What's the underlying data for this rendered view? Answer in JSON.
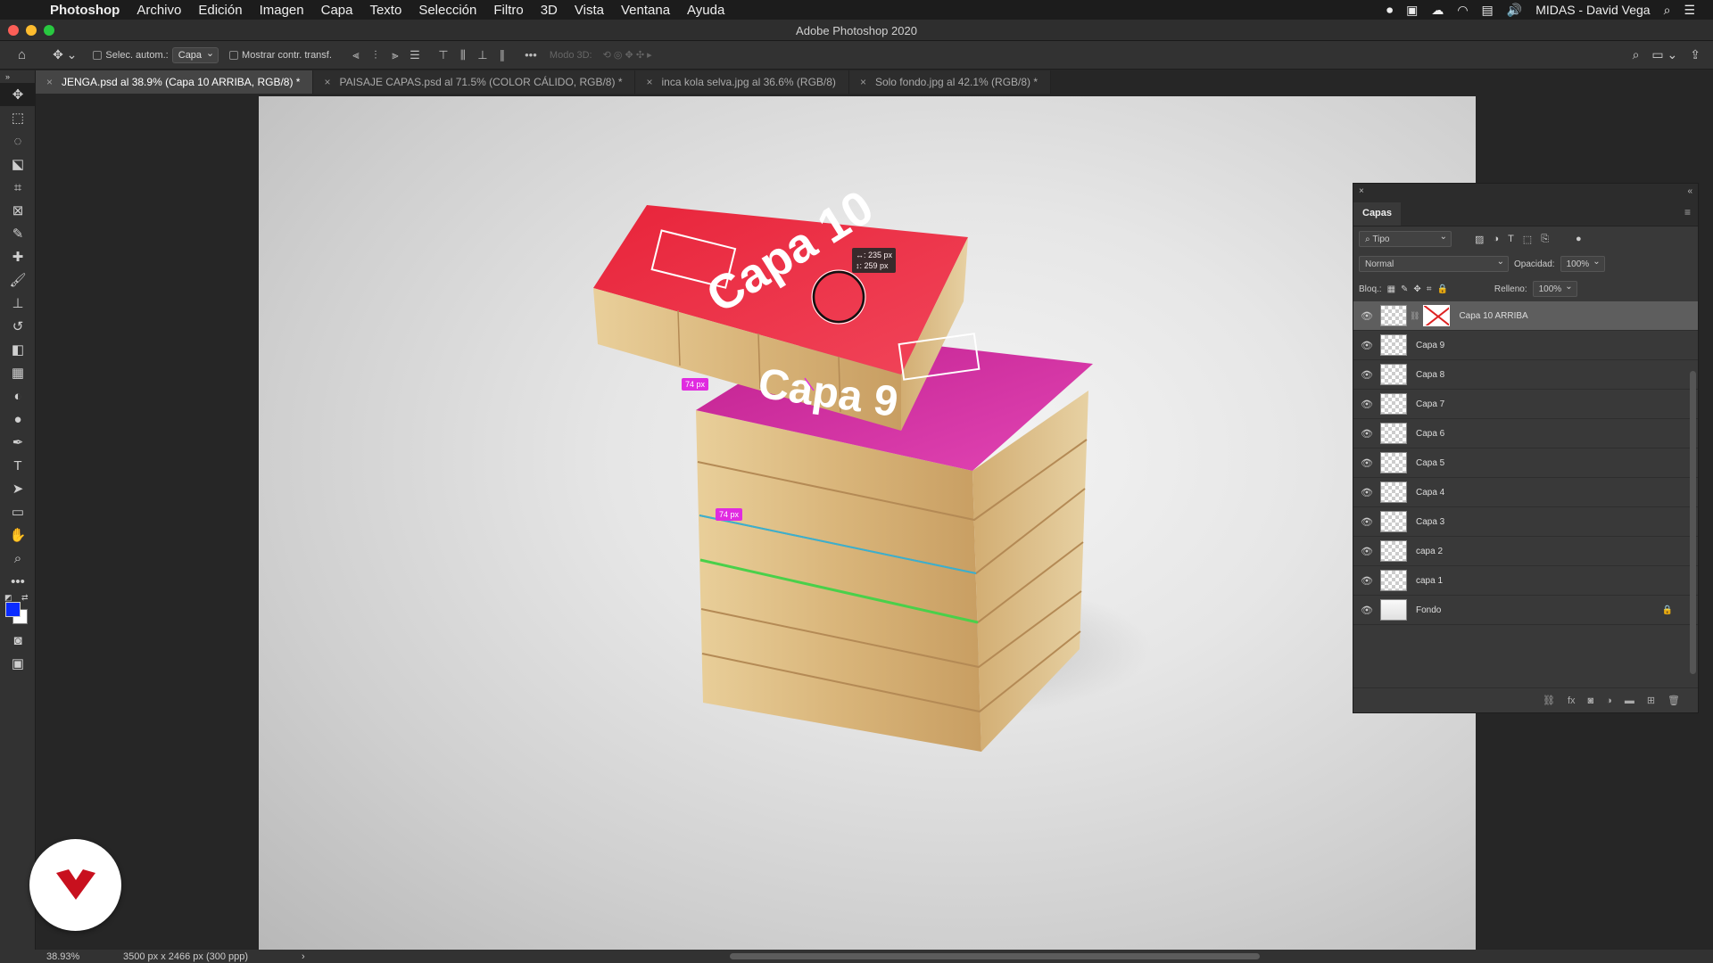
{
  "menubar": {
    "app": "Photoshop",
    "items": [
      "Archivo",
      "Edición",
      "Imagen",
      "Capa",
      "Texto",
      "Selección",
      "Filtro",
      "3D",
      "Vista",
      "Ventana",
      "Ayuda"
    ],
    "user": "MIDAS - David Vega"
  },
  "window": {
    "title": "Adobe Photoshop 2020"
  },
  "options": {
    "auto_select_label": "Selec. autom.:",
    "auto_select_value": "Capa",
    "show_transform_label": "Mostrar contr. transf.",
    "mode3d_label": "Modo 3D:"
  },
  "tabs": [
    {
      "label": "JENGA.psd al 38.9% (Capa 10 ARRIBA, RGB/8) *",
      "active": true
    },
    {
      "label": "PAISAJE CAPAS.psd al 71.5% (COLOR CÁLIDO, RGB/8) *",
      "active": false
    },
    {
      "label": "inca kola selva.jpg al 36.6% (RGB/8)",
      "active": false
    },
    {
      "label": "Solo fondo.jpg al 42.1% (RGB/8) *",
      "active": false
    }
  ],
  "canvas": {
    "top_block_text": "Capa 10",
    "lower_block_text": "Capa 9",
    "info_x": "↔: 235 px",
    "info_y": "↕: 259 px",
    "measure_1": "74 px",
    "measure_2": "74 px"
  },
  "layers_panel": {
    "title": "Capas",
    "filter_kind": "Tipo",
    "blend_mode": "Normal",
    "opacity_label": "Opacidad:",
    "opacity_value": "100%",
    "lock_label": "Bloq.:",
    "fill_label": "Relleno:",
    "fill_value": "100%",
    "layers": [
      {
        "name": "Capa 10 ARRIBA",
        "active": true
      },
      {
        "name": "Capa 9"
      },
      {
        "name": "Capa 8"
      },
      {
        "name": "Capa 7"
      },
      {
        "name": "Capa 6"
      },
      {
        "name": "Capa 5"
      },
      {
        "name": "Capa 4"
      },
      {
        "name": "Capa 3"
      },
      {
        "name": "capa 2"
      },
      {
        "name": "capa 1"
      },
      {
        "name": "Fondo",
        "locked": true
      }
    ]
  },
  "status": {
    "zoom": "38.93%",
    "doc_size": "3500 px x 2466 px (300 ppp)"
  },
  "colors": {
    "foreground": "#0a2bff",
    "background": "#ffffff",
    "measure_guide": "#e02be0",
    "logo": "#c8101e"
  }
}
